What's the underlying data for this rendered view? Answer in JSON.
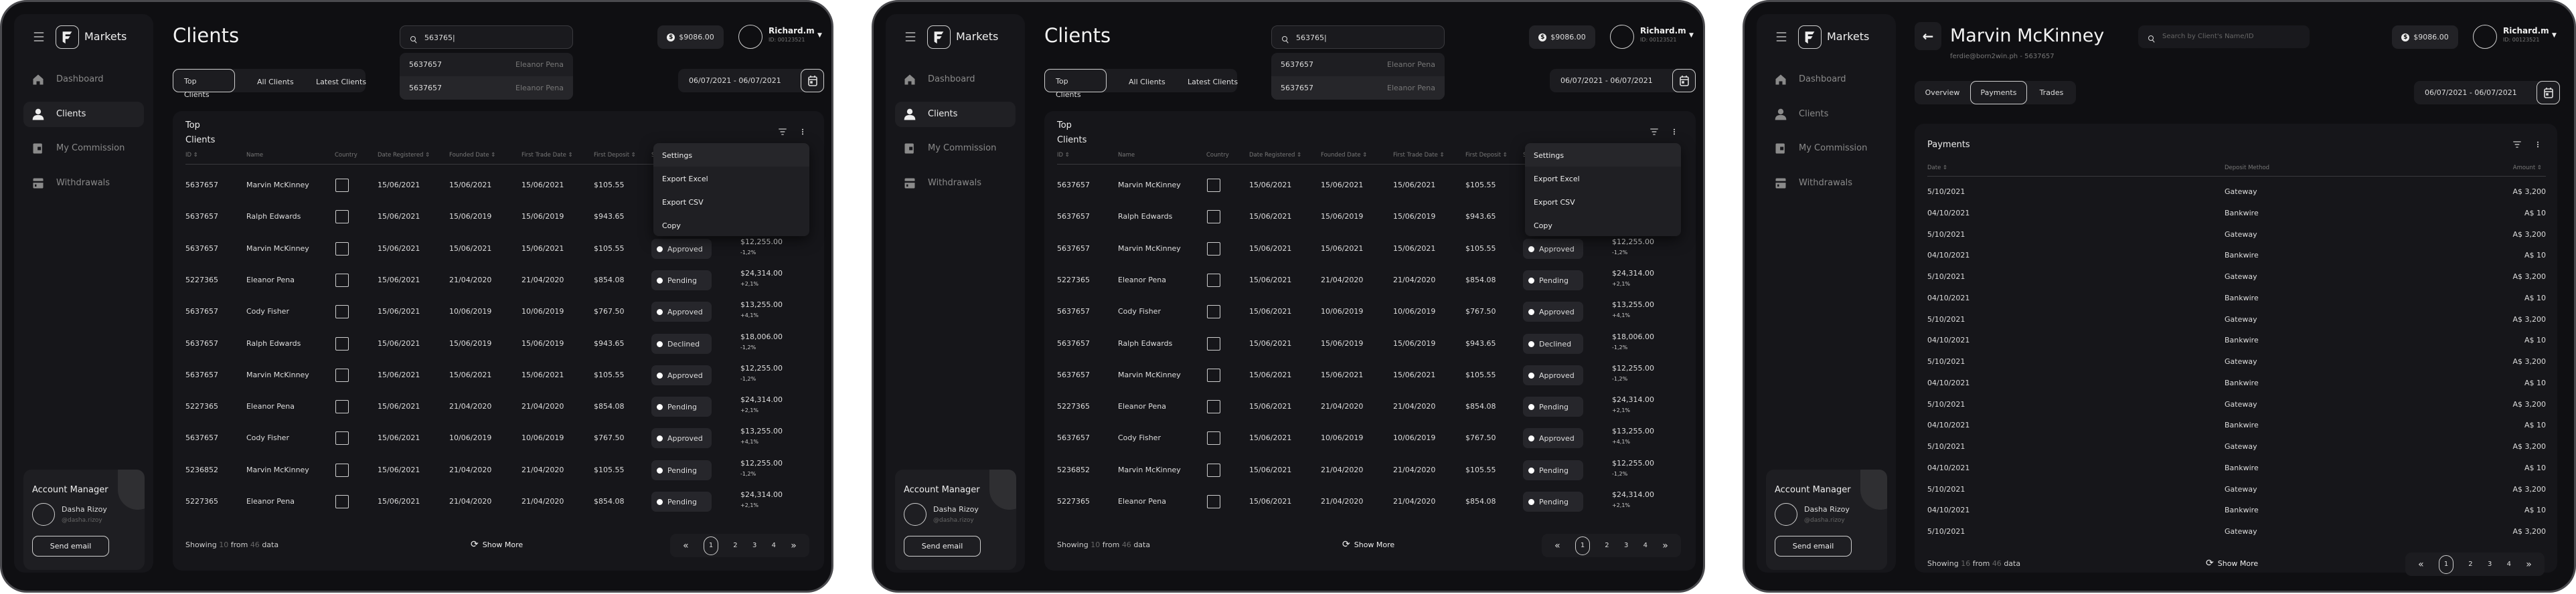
{
  "app": {
    "brand": "Markets",
    "nav": [
      {
        "label": "Dashboard",
        "icon": "home-icon"
      },
      {
        "label": "Clients",
        "icon": "user-icon",
        "active": true
      },
      {
        "label": "My Commission",
        "icon": "wallet-icon"
      },
      {
        "label": "Withdrawals",
        "icon": "card-icon"
      }
    ],
    "account_manager": {
      "title": "Account Manager",
      "name": "Dasha Rizoy",
      "handle": "@dasha.rizoy",
      "button": "Send email"
    },
    "balance": "$9086.00",
    "user": {
      "name": "Richard.m",
      "id": "ID: 00123521"
    },
    "date_range": "06/07/2021 - 06/07/2021",
    "pagination": {
      "prev": "«",
      "pages": [
        "1",
        "2",
        "3",
        "4"
      ],
      "current": "1",
      "next": "»"
    },
    "show_more": "Show More"
  },
  "clients_page": {
    "title": "Clients",
    "search_value": "563765|",
    "suggestions": [
      {
        "id": "5637657",
        "name": "Eleanor Pena"
      },
      {
        "id": "5637657",
        "name": "Eleanor Pena"
      }
    ],
    "tabs": [
      {
        "label": "Top Clients",
        "active": true
      },
      {
        "label": "All Clients"
      },
      {
        "label": "Latest Clients"
      }
    ],
    "card_title_1": "Top",
    "card_title_2": "Clients",
    "columns": [
      "ID ⇕",
      "Name",
      "Country",
      "Date Registered ⇕",
      "Founded Date ⇕",
      "First Trade Date ⇕",
      "First Deposit ⇕",
      "Status"
    ],
    "rows": [
      {
        "id": "5637657",
        "name": "Marvin McKinney",
        "reg": "15/06/2021",
        "founded": "15/06/2021",
        "trade": "15/06/2021",
        "deposit": "$105.55"
      },
      {
        "id": "5637657",
        "name": "Ralph Edwards",
        "reg": "15/06/2021",
        "founded": "15/06/2019",
        "trade": "15/06/2019",
        "deposit": "$943.65"
      },
      {
        "id": "5637657",
        "name": "Marvin McKinney",
        "reg": "15/06/2021",
        "founded": "15/06/2021",
        "trade": "15/06/2021",
        "deposit": "$105.55",
        "status": "Approved",
        "value": "$12,255.00",
        "change": "-1,2%"
      },
      {
        "id": "5227365",
        "name": "Eleanor Pena",
        "reg": "15/06/2021",
        "founded": "21/04/2020",
        "trade": "21/04/2020",
        "deposit": "$854.08",
        "status": "Pending",
        "value": "$24,314.00",
        "change": "+2,1%"
      },
      {
        "id": "5637657",
        "name": "Cody Fisher",
        "reg": "15/06/2021",
        "founded": "10/06/2019",
        "trade": "10/06/2019",
        "deposit": "$767.50",
        "status": "Approved",
        "value": "$13,255.00",
        "change": "+4,1%"
      },
      {
        "id": "5637657",
        "name": "Ralph Edwards",
        "reg": "15/06/2021",
        "founded": "15/06/2019",
        "trade": "15/06/2019",
        "deposit": "$943.65",
        "status": "Declined",
        "value": "$18,006.00",
        "change": "-1,2%"
      },
      {
        "id": "5637657",
        "name": "Marvin McKinney",
        "reg": "15/06/2021",
        "founded": "15/06/2021",
        "trade": "15/06/2021",
        "deposit": "$105.55",
        "status": "Approved",
        "value": "$12,255.00",
        "change": "-1,2%"
      },
      {
        "id": "5227365",
        "name": "Eleanor Pena",
        "reg": "15/06/2021",
        "founded": "21/04/2020",
        "trade": "21/04/2020",
        "deposit": "$854.08",
        "status": "Pending",
        "value": "$24,314.00",
        "change": "+2,1%"
      },
      {
        "id": "5637657",
        "name": "Cody Fisher",
        "reg": "15/06/2021",
        "founded": "10/06/2019",
        "trade": "10/06/2019",
        "deposit": "$767.50",
        "status": "Approved",
        "value": "$13,255.00",
        "change": "+4,1%"
      },
      {
        "id": "5236852",
        "name": "Marvin McKinney",
        "reg": "15/06/2021",
        "founded": "21/04/2020",
        "trade": "21/04/2020",
        "deposit": "$105.55",
        "status": "Pending",
        "value": "$12,255.00",
        "change": "-1,2%"
      },
      {
        "id": "5227365",
        "name": "Eleanor Pena",
        "reg": "15/06/2021",
        "founded": "21/04/2020",
        "trade": "21/04/2020",
        "deposit": "$854.08",
        "status": "Pending",
        "value": "$24,314.00",
        "change": "+2,1%"
      }
    ],
    "menu": [
      "Settings",
      "Export Excel",
      "Export CSV",
      "Copy"
    ],
    "showing": {
      "prefix": "Showing",
      "count": "10",
      "mid": "from",
      "total": "46",
      "suffix": "data"
    }
  },
  "client_detail": {
    "title": "Marvin McKinney",
    "subtitle": "ferdie@born2win.ph - 5637657",
    "search_placeholder": "Search by Client's Name/ID",
    "tabs": [
      {
        "label": "Overview"
      },
      {
        "label": "Payments",
        "active": true
      },
      {
        "label": "Trades"
      }
    ],
    "card_title": "Payments",
    "columns": [
      "Date ⇕",
      "Deposit Method",
      "Amount ⇕"
    ],
    "rows": [
      {
        "date": "5/10/2021",
        "method": "Gateway",
        "amount": "A$ 3,200"
      },
      {
        "date": "04/10/2021",
        "method": "Bankwire",
        "amount": "A$ 10"
      },
      {
        "date": "5/10/2021",
        "method": "Gateway",
        "amount": "A$ 3,200"
      },
      {
        "date": "04/10/2021",
        "method": "Bankwire",
        "amount": "A$ 10"
      },
      {
        "date": "5/10/2021",
        "method": "Gateway",
        "amount": "A$ 3,200"
      },
      {
        "date": "04/10/2021",
        "method": "Bankwire",
        "amount": "A$ 10"
      },
      {
        "date": "5/10/2021",
        "method": "Gateway",
        "amount": "A$ 3,200"
      },
      {
        "date": "04/10/2021",
        "method": "Bankwire",
        "amount": "A$ 10"
      },
      {
        "date": "5/10/2021",
        "method": "Gateway",
        "amount": "A$ 3,200"
      },
      {
        "date": "04/10/2021",
        "method": "Bankwire",
        "amount": "A$ 10"
      },
      {
        "date": "5/10/2021",
        "method": "Gateway",
        "amount": "A$ 3,200"
      },
      {
        "date": "04/10/2021",
        "method": "Bankwire",
        "amount": "A$ 10"
      },
      {
        "date": "5/10/2021",
        "method": "Gateway",
        "amount": "A$ 3,200"
      },
      {
        "date": "04/10/2021",
        "method": "Bankwire",
        "amount": "A$ 10"
      },
      {
        "date": "5/10/2021",
        "method": "Gateway",
        "amount": "A$ 3,200"
      },
      {
        "date": "04/10/2021",
        "method": "Bankwire",
        "amount": "A$ 10"
      },
      {
        "date": "5/10/2021",
        "method": "Gateway",
        "amount": "A$ 3,200"
      }
    ],
    "showing": {
      "prefix": "Showing",
      "count": "16",
      "mid": "from",
      "total": "46",
      "suffix": "data"
    }
  },
  "colors": {
    "background": "#0f0f12",
    "surface": "#16161a",
    "pill": "#1c1c20",
    "text": "#e6e6e6",
    "muted": "#8c8c90",
    "frame": "#4a4a4e"
  }
}
